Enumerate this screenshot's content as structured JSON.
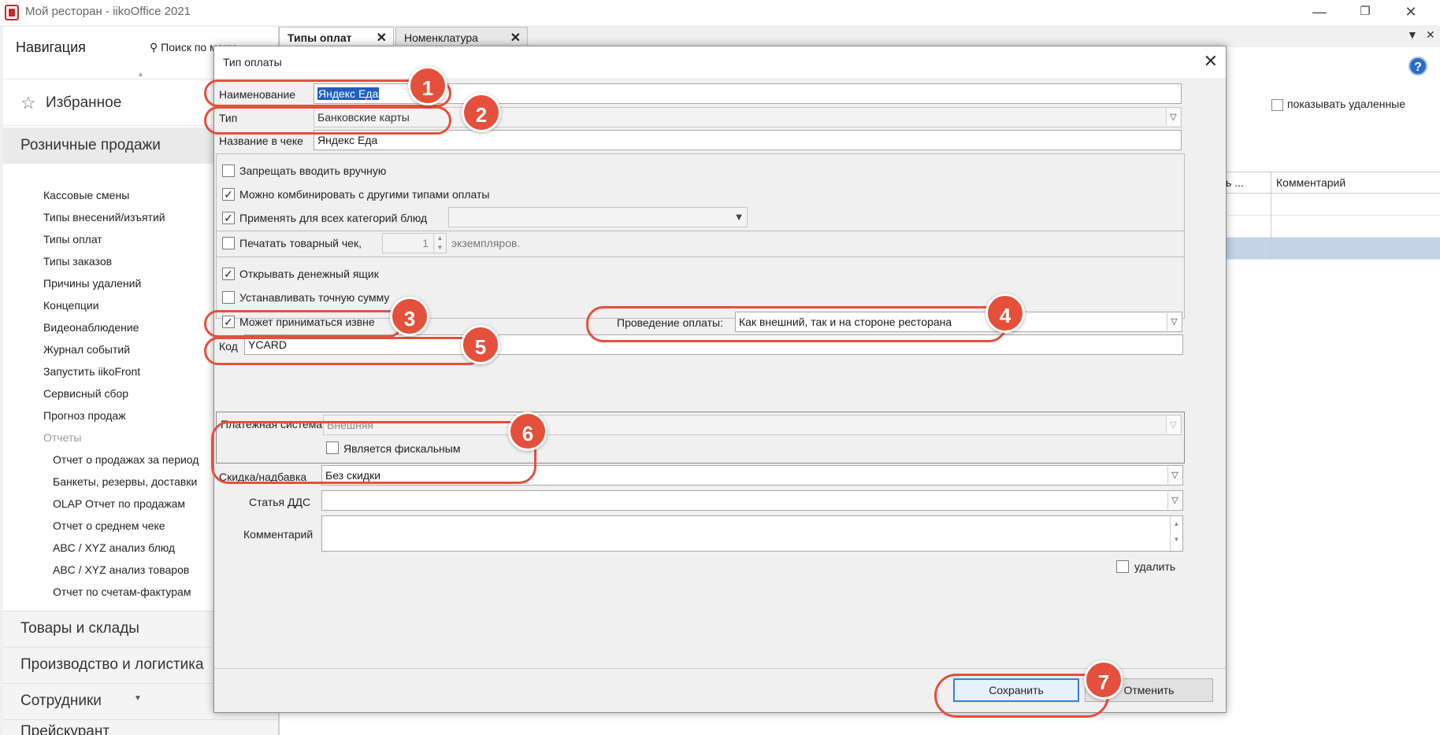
{
  "window": {
    "title": "Мой ресторан - iikoOffice 2021",
    "minimize": "—",
    "maximize": "❐",
    "close": "✕"
  },
  "nav": {
    "title": "Навигация",
    "search": "⚲ Поиск по меню",
    "favorites": "Избранное",
    "active_section": "Розничные продажи",
    "items": [
      "Кассовые смены",
      "Типы внесений/изъятий",
      "Типы оплат",
      "Типы заказов",
      "Причины удалений",
      "Концепции",
      "Видеонаблюдение",
      "Журнал событий",
      "Запустить iikoFront",
      "Сервисный сбор",
      "Прогноз продаж"
    ],
    "reports_header": "Отчеты",
    "reports": [
      "Отчет о продажах за период",
      "Банкеты, резервы, доставки",
      "OLAP Отчет по продажам",
      "Отчет о среднем чеке",
      "ABC / XYZ анализ блюд",
      "ABC / XYZ анализ товаров",
      "Отчет по счетам-фактурам"
    ],
    "bottom_sections": [
      "Товары и склады",
      "Производство и логистика",
      "Сотрудники",
      "Прейскурант"
    ]
  },
  "tabs": [
    {
      "label": "Типы оплат",
      "close": "✕"
    },
    {
      "label": "Номенклатура",
      "close": "✕"
    }
  ],
  "background": {
    "help": "?",
    "show_deleted": "показывать удаленные",
    "col_partial": "ь ...",
    "col_comment": "Комментарий"
  },
  "dialog": {
    "title": "Тип оплаты",
    "close": "✕",
    "name_label": "Наименование",
    "name_value": "Яндекс Еда",
    "type_label": "Тип",
    "type_value": "Банковские карты",
    "receipt_name_label": "Название в чеке",
    "receipt_name_value": "Яндекс Еда",
    "cb_forbid_manual": "Запрещать вводить вручную",
    "cb_combine": "Можно комбинировать с другими типами оплаты",
    "cb_all_categories": "Применять для всех категорий блюд",
    "cb_print_receipt": "Печатать товарный чек,",
    "copies_value": "1",
    "copies_suffix": "экземпляров.",
    "cb_open_drawer": "Открывать денежный ящик",
    "cb_exact_sum": "Устанавливать точную сумму",
    "cb_external": "Может приниматься извне",
    "processing_label": "Проведение оплаты:",
    "processing_value": "Как внешний, так и на стороне ресторана",
    "code_label": "Код",
    "code_value": "YCARD",
    "payment_system_label": "Платежная система:",
    "payment_system_value": "Внешняя",
    "cb_fiscal": "Является фискальным",
    "discount_label": "Скидка/надбавка",
    "discount_value": "Без скидки",
    "dds_label": "Статья ДДС",
    "dds_value": "",
    "comment_label": "Комментарий",
    "comment_value": "",
    "cb_delete": "удалить",
    "save": "Сохранить",
    "cancel": "Отменить"
  },
  "annotations": [
    "1",
    "2",
    "3",
    "4",
    "5",
    "6",
    "7"
  ],
  "colors": {
    "annotation": "#e4503b",
    "selection": "#1f5fbf",
    "primary_border": "#3a7fd4"
  }
}
